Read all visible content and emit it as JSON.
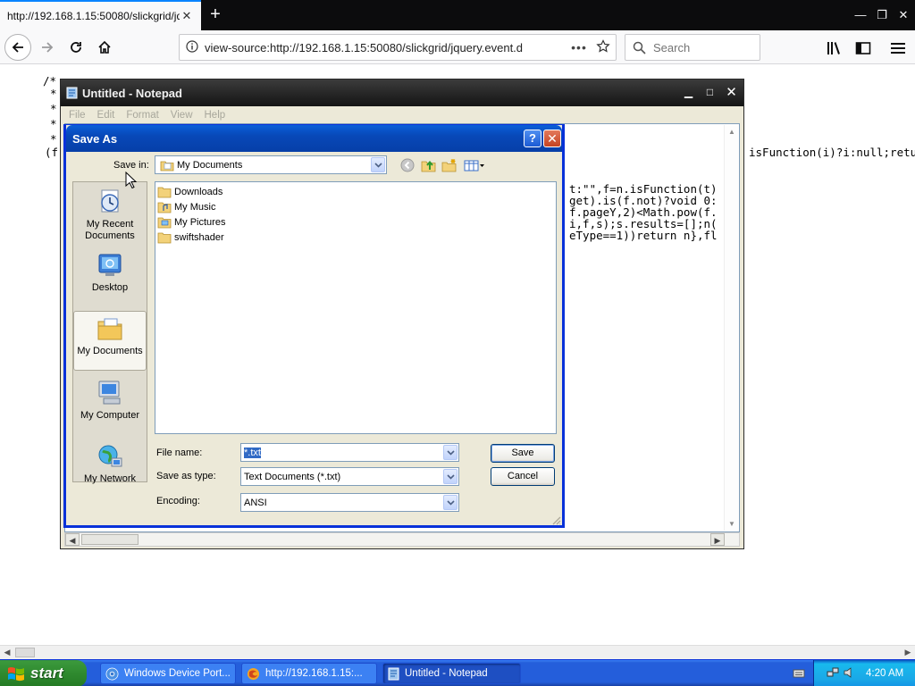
{
  "browser": {
    "tab_title": "http://192.168.1.15:50080/slickgrid/jq",
    "url": "view-source:http://192.168.1.15:50080/slickgrid/jquery.event.d",
    "search_placeholder": "Search",
    "url_dots": "•••"
  },
  "page_source": {
    "comment_open": "/*",
    "star_lines": [
      "*",
      "*",
      "*",
      "*"
    ],
    "paren_line": "(f",
    "right_fragment": "isFunction(i)?i:null;retu"
  },
  "notepad": {
    "title": "Untitled - Notepad",
    "menus": [
      "File",
      "Edit",
      "Format",
      "View",
      "Help"
    ],
    "code_lines": [
      "t:\"\",f=n.isFunction(t)",
      "get).is(f.not)?void 0:",
      "f.pageY,2)<Math.pow(f.",
      "i,f,s);s.results=[];n(",
      "eType==1))return n},fl"
    ]
  },
  "save_as": {
    "title": "Save As",
    "help_label": "?",
    "save_in_label": "Save in:",
    "save_in_value": "My Documents",
    "places": [
      "My Recent Documents",
      "Desktop",
      "My Documents",
      "My Computer",
      "My Network"
    ],
    "selected_place": "My Documents",
    "files": [
      "Downloads",
      "My Music",
      "My Pictures",
      "swiftshader"
    ],
    "file_name_label": "File name:",
    "file_name_value": "*.txt",
    "save_type_label": "Save as type:",
    "save_type_value": "Text Documents (*.txt)",
    "encoding_label": "Encoding:",
    "encoding_value": "ANSI",
    "save_button": "Save",
    "cancel_button": "Cancel"
  },
  "taskbar": {
    "start_label": "start",
    "tasks": [
      "Windows Device Port...",
      "http://192.168.1.15:...",
      "Untitled - Notepad"
    ],
    "active_task": "Untitled - Notepad",
    "clock": "4:20 AM"
  },
  "colors": {
    "xp_title_blue": "#0a5fd8",
    "xp_face": "#ece9d8",
    "taskbar_blue": "#245edb",
    "start_green": "#2f8a2f",
    "firefox_dark": "#0c0c0d"
  }
}
